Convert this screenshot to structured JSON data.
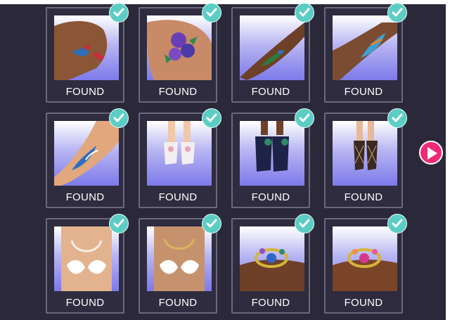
{
  "items": [
    {
      "label": "FOUND",
      "item": "tattoo-bird-cherries",
      "found": true
    },
    {
      "label": "FOUND",
      "item": "tattoo-roses",
      "found": true
    },
    {
      "label": "FOUND",
      "item": "tattoo-peacock-feather",
      "found": true
    },
    {
      "label": "FOUND",
      "item": "tattoo-fish",
      "found": true
    },
    {
      "label": "FOUND",
      "item": "tattoo-koi",
      "found": true
    },
    {
      "label": "FOUND",
      "item": "heels-white-pink",
      "found": true
    },
    {
      "label": "FOUND",
      "item": "heels-navy-peacock",
      "found": true
    },
    {
      "label": "FOUND",
      "item": "heels-fishnet",
      "found": true
    },
    {
      "label": "FOUND",
      "item": "bikini-pearls",
      "found": true
    },
    {
      "label": "FOUND",
      "item": "bikini-gold-chains",
      "found": true
    },
    {
      "label": "FOUND",
      "item": "bracelet-blue-gems",
      "found": true
    },
    {
      "label": "FOUND",
      "item": "bracelet-pink-gems",
      "found": true
    }
  ],
  "next_button": {
    "icon": "play-icon"
  },
  "colors": {
    "background": "#2b2939",
    "card_border": "#6a6880",
    "check": "#5ccdc4",
    "next": "#ee2a76"
  }
}
